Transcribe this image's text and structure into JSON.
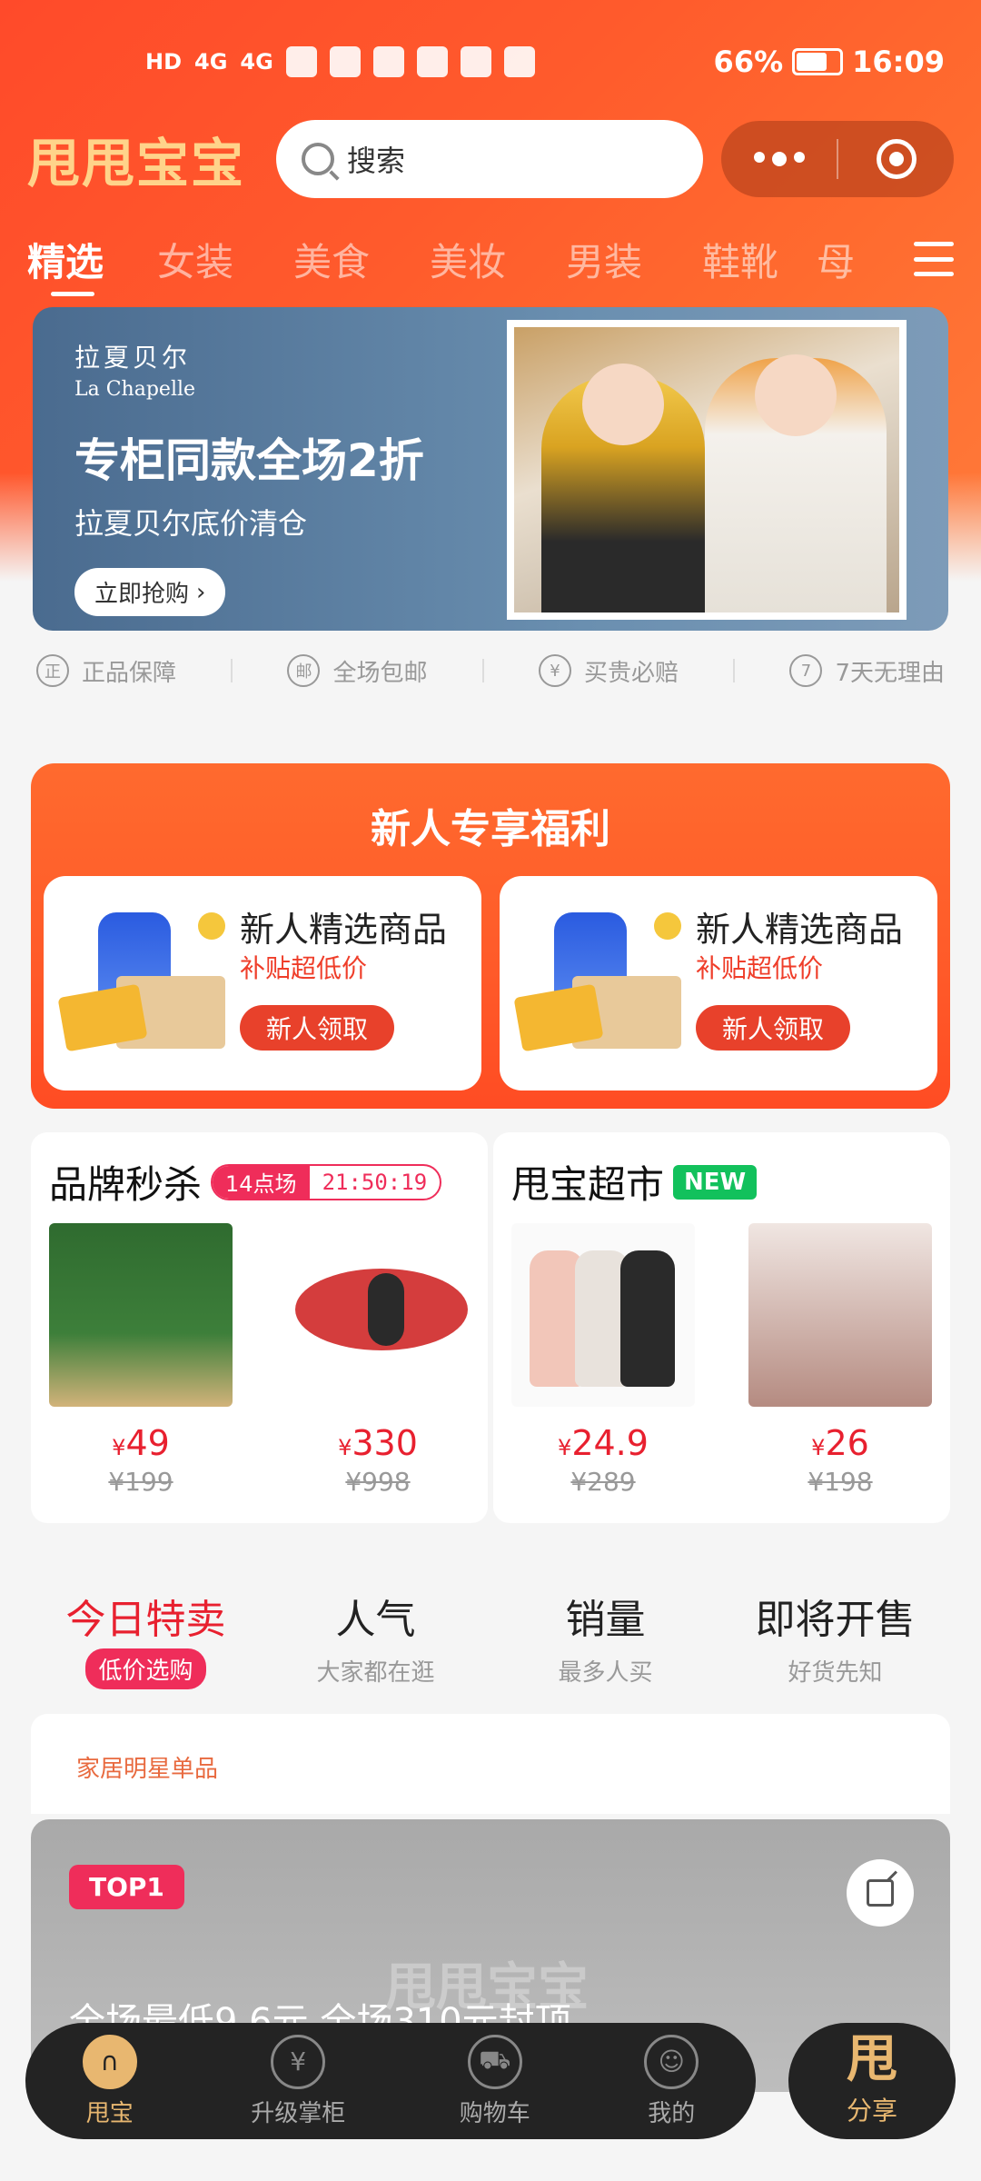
{
  "status_bar": {
    "hd": "HD",
    "signal1": "4G",
    "signal2": "4G",
    "battery": "66%",
    "time": "16:09"
  },
  "header": {
    "logo": "甩甩宝宝",
    "search_placeholder": "搜索"
  },
  "categories": [
    "精选",
    "女装",
    "美食",
    "美妆",
    "男装",
    "鞋靴",
    "母"
  ],
  "banner": {
    "brand_cn": "拉夏贝尔",
    "brand_en": "La Chapelle",
    "title": "专柜同款全场2折",
    "subtitle": "拉夏贝尔底价清仓",
    "button": "立即抢购"
  },
  "guarantees": [
    {
      "icon": "正",
      "label": "正品保障"
    },
    {
      "icon": "邮",
      "label": "全场包邮"
    },
    {
      "icon": "¥",
      "label": "买贵必赔"
    },
    {
      "icon": "7",
      "label": "7天无理由"
    }
  ],
  "new_user": {
    "title": "新人专享福利",
    "cards": [
      {
        "name": "新人精选商品",
        "sub": "补贴超低价",
        "button": "新人领取"
      },
      {
        "name": "新人精选商品",
        "sub": "补贴超低价",
        "button": "新人领取"
      }
    ]
  },
  "flash_sale": {
    "title": "品牌秒杀",
    "session": "14点场",
    "countdown": "21:50:19",
    "items": [
      {
        "price": "49",
        "old_price": "¥199"
      },
      {
        "price": "330",
        "old_price": "¥998"
      }
    ]
  },
  "market": {
    "title": "甩宝超市",
    "badge": "NEW",
    "items": [
      {
        "price": "24.9",
        "old_price": "¥289"
      },
      {
        "price": "26",
        "old_price": "¥198"
      }
    ]
  },
  "sort_tabs": [
    {
      "title": "今日特卖",
      "sub": "低价选购"
    },
    {
      "title": "人气",
      "sub": "大家都在逛"
    },
    {
      "title": "销量",
      "sub": "最多人买"
    },
    {
      "title": "即将开售",
      "sub": "好货先知"
    }
  ],
  "feed": {
    "label": "家居明星单品",
    "top_badge": "TOP1",
    "watermark": "甩甩宝宝",
    "title": "全场最低9.6元 全场310元封顶"
  },
  "bottom_nav": [
    {
      "label": "甩宝",
      "icon": "home-icon"
    },
    {
      "label": "升级掌柜",
      "icon": "yen-icon"
    },
    {
      "label": "购物车",
      "icon": "cart-icon"
    },
    {
      "label": "我的",
      "icon": "user-icon"
    }
  ],
  "share_fab": {
    "logo": "甩",
    "label": "分享"
  },
  "colors": {
    "accent": "#ff5a2c",
    "price": "#e8202f",
    "gold": "#e8b770",
    "badge_pink": "#ef2d5a",
    "new_green": "#12c15c"
  }
}
